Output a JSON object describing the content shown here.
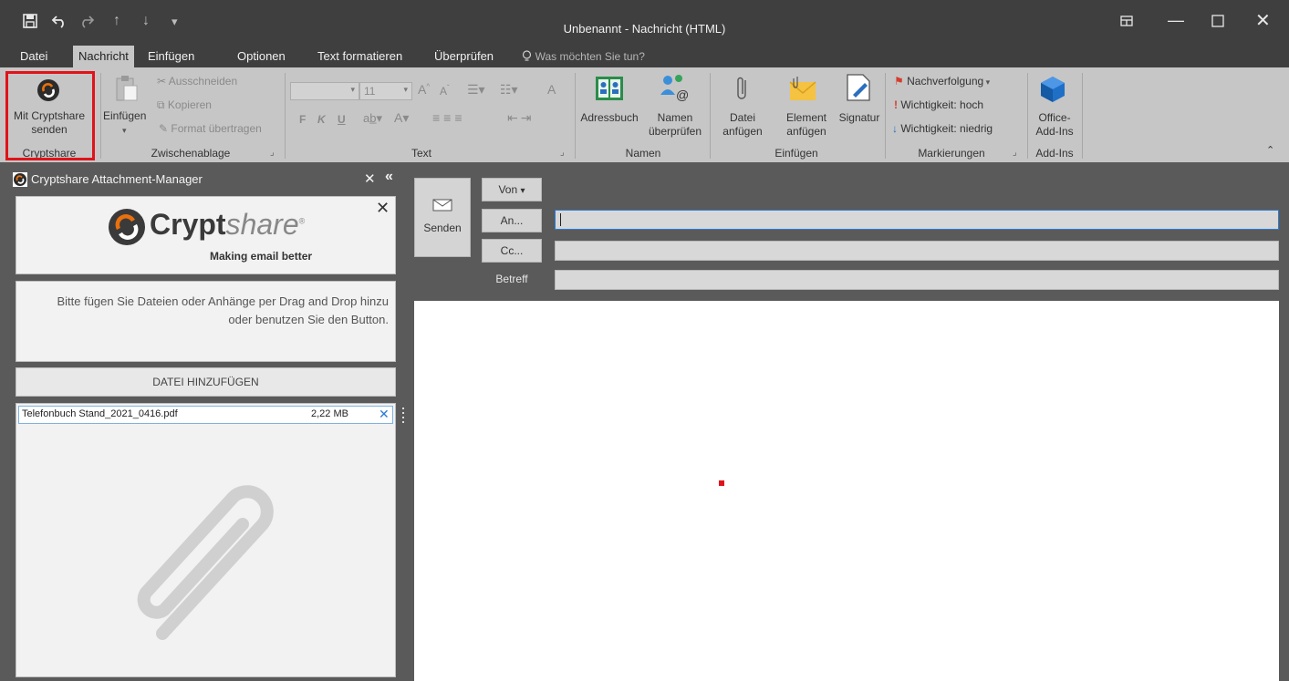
{
  "window": {
    "title": "Unbenannt - Nachricht (HTML)",
    "qat_icons": [
      "save-icon",
      "undo-icon",
      "redo-icon",
      "up-icon",
      "down-icon",
      "customize-icon"
    ],
    "controls": [
      "restore-ribbon-icon",
      "minimize-icon",
      "maximize-icon",
      "close-icon"
    ]
  },
  "tabs": [
    {
      "label": "Datei"
    },
    {
      "label": "Nachricht",
      "active": true
    },
    {
      "label": "Einfügen"
    },
    {
      "label": "Optionen"
    },
    {
      "label": "Text formatieren"
    },
    {
      "label": "Überprüfen"
    }
  ],
  "tell_me": "Was möchten Sie tun?",
  "ribbon": {
    "cryptshare": {
      "button": "Mit Cryptshare senden",
      "group": "Cryptshare"
    },
    "clipboard": {
      "paste": "Einfügen",
      "cut": "Ausschneiden",
      "copy": "Kopieren",
      "format_painter": "Format übertragen",
      "group": "Zwischenablage"
    },
    "text": {
      "font_size": "11",
      "bold": "F",
      "italic": "K",
      "underline": "U",
      "group": "Text"
    },
    "names": {
      "address_book": "Adressbuch",
      "check_names": "Namen überprüfen",
      "group": "Namen"
    },
    "include": {
      "attach_file": "Datei anfügen",
      "attach_item": "Element anfügen",
      "signature": "Signatur",
      "group": "Einfügen"
    },
    "tags": {
      "follow_up": "Nachverfolgung",
      "high": "Wichtigkeit: hoch",
      "low": "Wichtigkeit: niedrig",
      "group": "Markierungen"
    },
    "addins": {
      "office_addins": "Office-Add-Ins",
      "group": "Add-Ins"
    }
  },
  "pane": {
    "title": "Cryptshare Attachment-Manager",
    "logo_bold": "Crypt",
    "logo_light": "share",
    "tagline": "Making email better",
    "instructions": "Bitte fügen Sie Dateien oder Anhänge per Drag and Drop hinzu oder benutzen Sie den Button.",
    "add_button": "DATEI HINZUFÜGEN",
    "files": [
      {
        "name": "Telefonbuch Stand_2021_0416.pdf",
        "size": "2,22 MB"
      }
    ]
  },
  "compose": {
    "send": "Senden",
    "from": "Von",
    "to": "An...",
    "cc": "Cc...",
    "subject_label": "Betreff",
    "to_value": "",
    "cc_value": "",
    "subject_value": ""
  },
  "colors": {
    "accent": "#e0131a",
    "logo_orange": "#e8700e",
    "focus": "#2a7bd4"
  }
}
